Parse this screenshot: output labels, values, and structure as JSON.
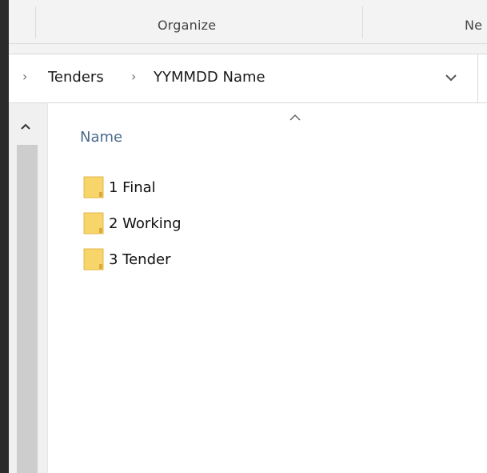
{
  "ribbon": {
    "organize_label": "Organize",
    "new_label": "Ne"
  },
  "address": {
    "crumbs": [
      "Tenders",
      "YYMMDD Name"
    ]
  },
  "file_list": {
    "column_name": "Name",
    "items": [
      {
        "name": "1 Final",
        "icon": "folder-icon"
      },
      {
        "name": "2 Working",
        "icon": "folder-icon"
      },
      {
        "name": "3 Tender",
        "icon": "folder-icon"
      }
    ]
  },
  "colors": {
    "folder": "#f7d56b",
    "folder_dark": "#dcaa37",
    "header_text": "#4a6c8c",
    "scroll_thumb": "#cdcdcd"
  }
}
